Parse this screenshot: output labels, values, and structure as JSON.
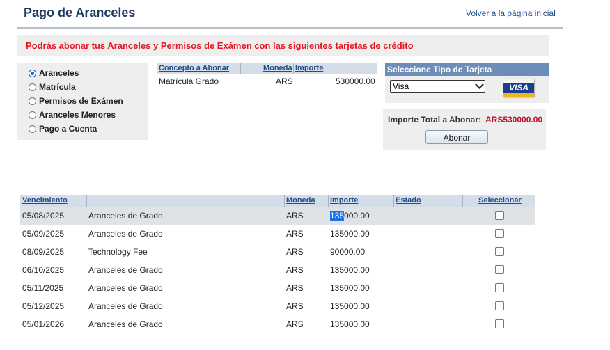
{
  "header": {
    "title": "Pago de Aranceles",
    "back_link": "Volver a la página inicial"
  },
  "notice": "Podrás abonar tus Aranceles y Permisos de Exámen con las siguientes tarjetas de crédito",
  "payment_types": {
    "selected": "Aranceles",
    "options": [
      "Aranceles",
      "Matrícula",
      "Permisos de Exámen",
      "Aranceles Menores",
      "Pago a Cuenta"
    ]
  },
  "concept_table": {
    "headers": [
      "Concepto a Abonar",
      "Moneda",
      "Importe"
    ],
    "rows": [
      {
        "concepto": "Matrícula Grado",
        "moneda": "ARS",
        "importe": "530000.00"
      }
    ]
  },
  "card_panel": {
    "header": "Seleccione Tipo de Tarjeta",
    "selected_card": "Visa",
    "logo_text": "VISA"
  },
  "total": {
    "label": "Importe Total a Abonar:",
    "value": "ARS530000.00",
    "button": "Abonar"
  },
  "due_table": {
    "headers": [
      "Vencimiento",
      "Moneda",
      "Importe",
      "Estado",
      "Seleccionar"
    ],
    "rows": [
      {
        "vencimiento": "05/08/2025",
        "concepto": "Aranceles de Grado",
        "moneda": "ARS",
        "importe_sel": "135",
        "importe_rest": "000.00",
        "estado": "",
        "checked": false
      },
      {
        "vencimiento": "05/09/2025",
        "concepto": "Aranceles de Grado",
        "moneda": "ARS",
        "importe": "135000.00",
        "estado": "",
        "checked": false
      },
      {
        "vencimiento": "08/09/2025",
        "concepto": "Technology Fee",
        "moneda": "ARS",
        "importe": "90000.00",
        "estado": "",
        "checked": false
      },
      {
        "vencimiento": "06/10/2025",
        "concepto": "Aranceles de Grado",
        "moneda": "ARS",
        "importe": "135000.00",
        "estado": "",
        "checked": false
      },
      {
        "vencimiento": "05/11/2025",
        "concepto": "Aranceles de Grado",
        "moneda": "ARS",
        "importe": "135000.00",
        "estado": "",
        "checked": false
      },
      {
        "vencimiento": "05/12/2025",
        "concepto": "Aranceles de Grado",
        "moneda": "ARS",
        "importe": "135000.00",
        "estado": "",
        "checked": false
      },
      {
        "vencimiento": "05/01/2026",
        "concepto": "Aranceles de Grado",
        "moneda": "ARS",
        "importe": "135000.00",
        "estado": "",
        "checked": false
      }
    ]
  },
  "colors": {
    "title": "#1f3b63",
    "notice_text": "#e8141e",
    "panel_header": "#6d8db8",
    "table_header": "#d5dde8",
    "total_value": "#c0102f",
    "selection": "#1a73e8"
  }
}
